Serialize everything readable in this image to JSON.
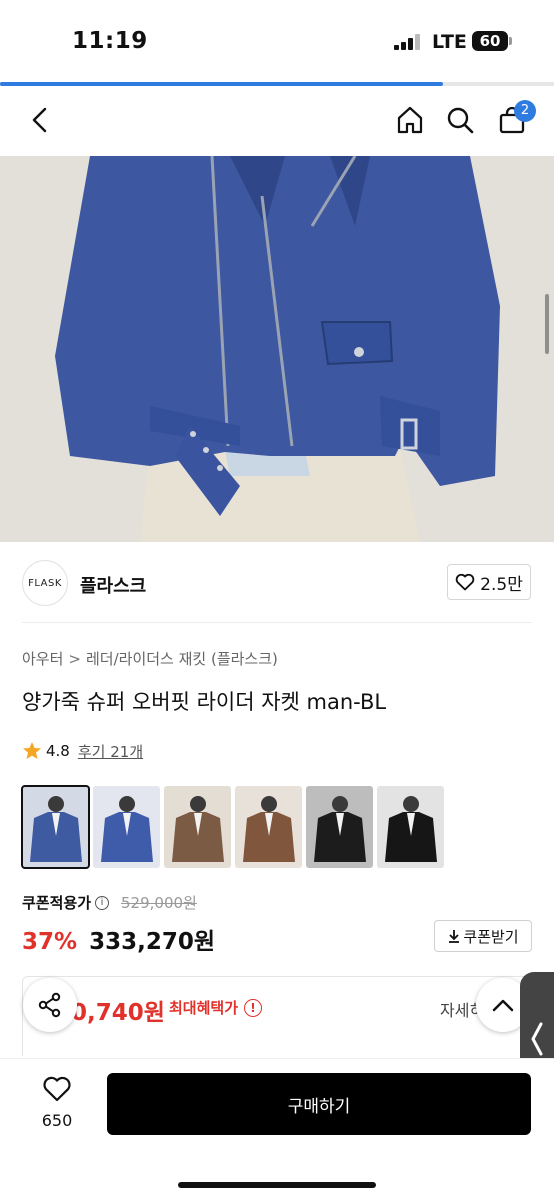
{
  "status_bar": {
    "time": "11:19",
    "network": "LTE",
    "battery": "60"
  },
  "header": {
    "cart_count": "2"
  },
  "load_progress": 0.8,
  "brand": {
    "logo_text": "FLASK",
    "name": "플라스크",
    "likes": "2.5만"
  },
  "breadcrumb": {
    "category": "아우터",
    "subcategory": "레더/라이더스 재킷 (플라스크)"
  },
  "product": {
    "title": "양가죽 슈퍼 오버핏 라이더 자켓 man-BL",
    "rating": "4.8",
    "reviews": "후기 21개"
  },
  "swatches": [
    {
      "label": "blue",
      "color": "#3e5aa0",
      "bg": "#d4d9e6"
    },
    {
      "label": "blue",
      "color": "#3f5cab",
      "bg": "#e3e6ee"
    },
    {
      "label": "brown",
      "color": "#7b5b44",
      "bg": "#e4ddd4"
    },
    {
      "label": "brown",
      "color": "#80573d",
      "bg": "#e8e1d9"
    },
    {
      "label": "black",
      "color": "#1c1c1c",
      "bg": "#bdbdbd"
    },
    {
      "label": "black",
      "color": "#161616",
      "bg": "#e3e3e3"
    }
  ],
  "pricing": {
    "coupon_label": "쿠폰적용가",
    "original_price": "529,000원",
    "discount": "37%",
    "sale_price": "333,270원",
    "coupon_button": "쿠폰받기",
    "benefit_price": "0,740원",
    "benefit_label": "최대혜택가",
    "benefit_detail": "자세히"
  },
  "bottom": {
    "wish_count": "650",
    "buy_label": "구매하기"
  },
  "colors": {
    "accent": "#2f7ce0",
    "sale_red": "#e0322b",
    "jacket_blue": "#3d57a0"
  }
}
